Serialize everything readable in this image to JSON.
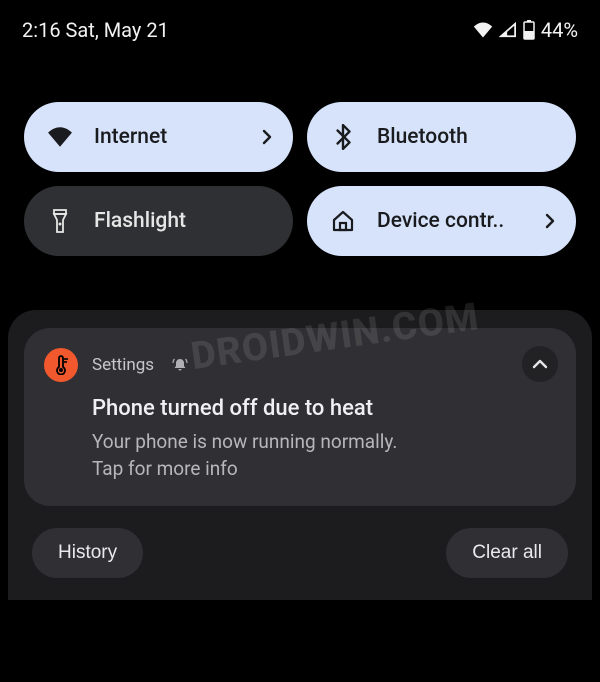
{
  "status": {
    "time_date": "2:16 Sat, May 21",
    "battery": "44%"
  },
  "qs": {
    "internet": "Internet",
    "bluetooth": "Bluetooth",
    "flashlight": "Flashlight",
    "device_controls": "Device contr.."
  },
  "notification": {
    "app": "Settings",
    "title": "Phone turned off due to heat",
    "body1": "Your phone is now running normally.",
    "body2": "Tap for more info"
  },
  "actions": {
    "history": "History",
    "clear_all": "Clear all"
  },
  "watermark": "DROIDWIN.COM"
}
